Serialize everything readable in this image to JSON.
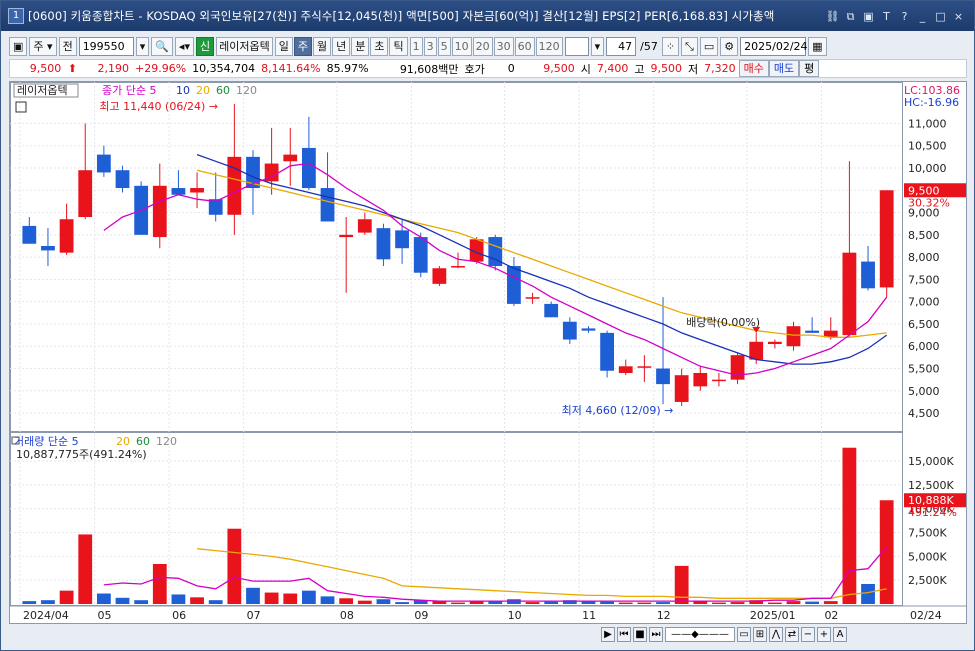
{
  "window": {
    "number": "1",
    "title": "[0600] 키움종합차트 - KOSDAQ 외국인보유[27(천)] 주식수[12,045(천)] 액면[500] 자본금[60(억)] 결산[12월] EPS[2] PER[6,168.83] 시가총액"
  },
  "toolbar": {
    "period_select": "주",
    "prev_label": "전",
    "code": "199550",
    "company": "레이저옵텍",
    "periods": [
      "일",
      "주",
      "월",
      "년",
      "분",
      "초",
      "틱"
    ],
    "selected_period": "주",
    "intervals": [
      "1",
      "3",
      "5",
      "10",
      "20",
      "30",
      "60",
      "120"
    ],
    "page": "47",
    "page_total": "/57",
    "date": "2025/02/24"
  },
  "quote": {
    "price": "9,500",
    "change": "2,190",
    "change_pct": "+29.96%",
    "volume": "10,354,704",
    "vol_pct": "8,141.64%",
    "rate": "85.97%",
    "amount": "91,608백만",
    "hoga_label": "호가",
    "hoga": "0",
    "hoga_price": "9,500",
    "open_label": "시",
    "open": "7,400",
    "high_label": "고",
    "high": "9,500",
    "low_label": "저",
    "low": "7,320",
    "buy": "매수",
    "sell": "매도",
    "avg": "평"
  },
  "chart_data": {
    "type": "candlestick",
    "company": "레이저옵텍",
    "legend_price": {
      "label": "종가 단순",
      "periods": [
        "5",
        "10",
        "20",
        "60",
        "120"
      ],
      "colors": [
        "#d400c8",
        "#1a2fb8",
        "#e8a900",
        "#1b8a3a",
        "#888888"
      ]
    },
    "legend_volume": {
      "label": "거래량 단순",
      "periods": [
        "5",
        "20",
        "60",
        "120"
      ]
    },
    "volume_readout": "10,887,775주(491.24%)",
    "lc": "LC:103.86",
    "hc": "HC:-16.96",
    "max_label": "최고 11,440 (06/24)",
    "min_label": "최저 4,660 (12/09)",
    "dividend_label": "배당락(0.00%)",
    "last_price_tag": "9,500",
    "last_pct_tag": "30.32%",
    "last_vol_tag": "10,888K",
    "last_vol_pct_tag": "491.24%",
    "price_axis": [
      "11,000",
      "10,500",
      "10,000",
      "9,500",
      "9,000",
      "8,500",
      "8,000",
      "7,500",
      "7,000",
      "6,500",
      "6,000",
      "5,500",
      "5,000",
      "4,500"
    ],
    "price_range": [
      4300,
      11750
    ],
    "volume_axis": [
      "15,000K",
      "12,500K",
      "10,000K",
      "7,500K",
      "5,000K",
      "2,500K"
    ],
    "volume_range": [
      0,
      17000
    ],
    "x_labels": [
      "2024/04",
      "05",
      "06",
      "07",
      "08",
      "09",
      "10",
      "11",
      "12",
      "2025/01",
      "02"
    ],
    "x_label_at": [
      0,
      4,
      8,
      12,
      17,
      21,
      26,
      30,
      34,
      39,
      43
    ],
    "right_date": "02/24",
    "candles": [
      {
        "o": 8700,
        "h": 8900,
        "l": 8300,
        "c": 8300,
        "v": 300
      },
      {
        "o": 8250,
        "h": 8650,
        "l": 7800,
        "c": 8150,
        "v": 400
      },
      {
        "o": 8100,
        "h": 9200,
        "l": 8050,
        "c": 8850,
        "v": 1400
      },
      {
        "o": 8900,
        "h": 11000,
        "l": 8850,
        "c": 9950,
        "v": 7300
      },
      {
        "o": 10300,
        "h": 10500,
        "l": 9800,
        "c": 9900,
        "v": 1100
      },
      {
        "o": 9950,
        "h": 10050,
        "l": 9450,
        "c": 9550,
        "v": 650
      },
      {
        "o": 9600,
        "h": 9700,
        "l": 8500,
        "c": 8500,
        "v": 400
      },
      {
        "o": 8450,
        "h": 10100,
        "l": 8200,
        "c": 9600,
        "v": 4200
      },
      {
        "o": 9550,
        "h": 9950,
        "l": 9400,
        "c": 9400,
        "v": 1000
      },
      {
        "o": 9450,
        "h": 9900,
        "l": 9100,
        "c": 9550,
        "v": 700
      },
      {
        "o": 9300,
        "h": 9900,
        "l": 8800,
        "c": 8950,
        "v": 400
      },
      {
        "o": 8950,
        "h": 11440,
        "l": 8500,
        "c": 10250,
        "v": 7900
      },
      {
        "o": 10250,
        "h": 10400,
        "l": 8950,
        "c": 9550,
        "v": 1700
      },
      {
        "o": 9700,
        "h": 10900,
        "l": 9400,
        "c": 10100,
        "v": 1200
      },
      {
        "o": 10150,
        "h": 10900,
        "l": 9600,
        "c": 10300,
        "v": 1100
      },
      {
        "o": 10450,
        "h": 11150,
        "l": 9500,
        "c": 9550,
        "v": 1400
      },
      {
        "o": 9550,
        "h": 10350,
        "l": 8800,
        "c": 8800,
        "v": 800
      },
      {
        "o": 8450,
        "h": 8900,
        "l": 7200,
        "c": 8500,
        "v": 600
      },
      {
        "o": 8550,
        "h": 9000,
        "l": 8500,
        "c": 8850,
        "v": 350
      },
      {
        "o": 8650,
        "h": 8750,
        "l": 7800,
        "c": 7950,
        "v": 500
      },
      {
        "o": 8600,
        "h": 8850,
        "l": 7850,
        "c": 8200,
        "v": 200
      },
      {
        "o": 8450,
        "h": 8550,
        "l": 7550,
        "c": 7650,
        "v": 400
      },
      {
        "o": 7400,
        "h": 7800,
        "l": 7350,
        "c": 7750,
        "v": 300
      },
      {
        "o": 7800,
        "h": 8100,
        "l": 7750,
        "c": 7800,
        "v": 150
      },
      {
        "o": 7900,
        "h": 8450,
        "l": 7850,
        "c": 8400,
        "v": 350
      },
      {
        "o": 8450,
        "h": 8500,
        "l": 7700,
        "c": 7800,
        "v": 350
      },
      {
        "o": 7800,
        "h": 8000,
        "l": 6900,
        "c": 6950,
        "v": 500
      },
      {
        "o": 7100,
        "h": 7200,
        "l": 6950,
        "c": 7100,
        "v": 200
      },
      {
        "o": 6950,
        "h": 7000,
        "l": 6650,
        "c": 6650,
        "v": 250
      },
      {
        "o": 6550,
        "h": 6650,
        "l": 6050,
        "c": 6150,
        "v": 400
      },
      {
        "o": 6400,
        "h": 6450,
        "l": 6300,
        "c": 6350,
        "v": 350
      },
      {
        "o": 6300,
        "h": 6350,
        "l": 5300,
        "c": 5450,
        "v": 250
      },
      {
        "o": 5400,
        "h": 5700,
        "l": 5350,
        "c": 5550,
        "v": 150
      },
      {
        "o": 5550,
        "h": 5800,
        "l": 5200,
        "c": 5550,
        "v": 150
      },
      {
        "o": 5500,
        "h": 7100,
        "l": 4700,
        "c": 5150,
        "v": 200
      },
      {
        "o": 4750,
        "h": 5500,
        "l": 4660,
        "c": 5350,
        "v": 4000
      },
      {
        "o": 5100,
        "h": 5550,
        "l": 5000,
        "c": 5400,
        "v": 300
      },
      {
        "o": 5250,
        "h": 5400,
        "l": 5100,
        "c": 5250,
        "v": 150
      },
      {
        "o": 5250,
        "h": 5850,
        "l": 5150,
        "c": 5800,
        "v": 200
      },
      {
        "o": 5700,
        "h": 6300,
        "l": 5600,
        "c": 6100,
        "v": 400
      },
      {
        "o": 6050,
        "h": 6150,
        "l": 5950,
        "c": 6100,
        "v": 150
      },
      {
        "o": 6000,
        "h": 6550,
        "l": 5900,
        "c": 6450,
        "v": 300
      },
      {
        "o": 6350,
        "h": 6650,
        "l": 6300,
        "c": 6300,
        "v": 250
      },
      {
        "o": 6200,
        "h": 6650,
        "l": 6150,
        "c": 6350,
        "v": 300
      },
      {
        "o": 6250,
        "h": 10150,
        "l": 6200,
        "c": 8100,
        "v": 16400
      },
      {
        "o": 7900,
        "h": 8250,
        "l": 7250,
        "c": 7300,
        "v": 2100
      },
      {
        "o": 7320,
        "h": 9500,
        "l": 7100,
        "c": 9500,
        "v": 10888
      }
    ],
    "ma5": [
      null,
      null,
      null,
      null,
      8600,
      8900,
      9050,
      9250,
      9400,
      9300,
      9250,
      9450,
      9650,
      9800,
      10050,
      10100,
      9850,
      9550,
      9300,
      9050,
      8700,
      8450,
      8150,
      7950,
      7900,
      7750,
      7550,
      7350,
      7100,
      6900,
      6700,
      6500,
      6300,
      6150,
      5950,
      5750,
      5550,
      5450,
      5350,
      5400,
      5500,
      5650,
      5800,
      5950,
      6250,
      6550,
      7100
    ],
    "ma10": [
      null,
      null,
      null,
      null,
      null,
      null,
      null,
      null,
      null,
      10300,
      10150,
      10000,
      9800,
      9650,
      9550,
      9450,
      9350,
      9250,
      9150,
      9000,
      8850,
      8700,
      8500,
      8300,
      8100,
      7950,
      7750,
      7600,
      7450,
      7300,
      7100,
      6950,
      6800,
      6650,
      6500,
      6300,
      6150,
      6000,
      5850,
      5700,
      5650,
      5600,
      5600,
      5650,
      5750,
      5950,
      6250
    ],
    "ma20": [
      null,
      null,
      null,
      null,
      null,
      null,
      null,
      null,
      null,
      9950,
      9850,
      9750,
      9650,
      9550,
      9450,
      9350,
      9250,
      9150,
      9050,
      8950,
      8850,
      8750,
      8650,
      8550,
      8400,
      8250,
      8100,
      7950,
      7800,
      7650,
      7500,
      7350,
      7200,
      7050,
      6900,
      6750,
      6650,
      6550,
      6450,
      6350,
      6300,
      6250,
      6250,
      6200,
      6200,
      6250,
      6300
    ],
    "vma5": [
      null,
      null,
      null,
      null,
      2000,
      2200,
      2100,
      2800,
      2700,
      1900,
      1600,
      2800,
      2400,
      2400,
      2400,
      2700,
      1400,
      1100,
      800,
      700,
      500,
      400,
      300,
      300,
      300,
      300,
      300,
      300,
      300,
      300,
      300,
      300,
      300,
      300,
      300,
      300,
      300,
      300,
      300,
      300,
      400,
      400,
      600,
      600,
      3500,
      3700,
      6000
    ],
    "vma20": [
      null,
      null,
      null,
      null,
      null,
      null,
      null,
      null,
      null,
      5800,
      5600,
      5400,
      5200,
      5000,
      4700,
      4300,
      3900,
      3500,
      3100,
      2700,
      1900,
      1800,
      1700,
      1600,
      1500,
      1400,
      1300,
      1200,
      1100,
      1000,
      900,
      900,
      800,
      800,
      800,
      700,
      700,
      600,
      600,
      600,
      600,
      600,
      600,
      600,
      1000,
      1200,
      1600
    ]
  }
}
